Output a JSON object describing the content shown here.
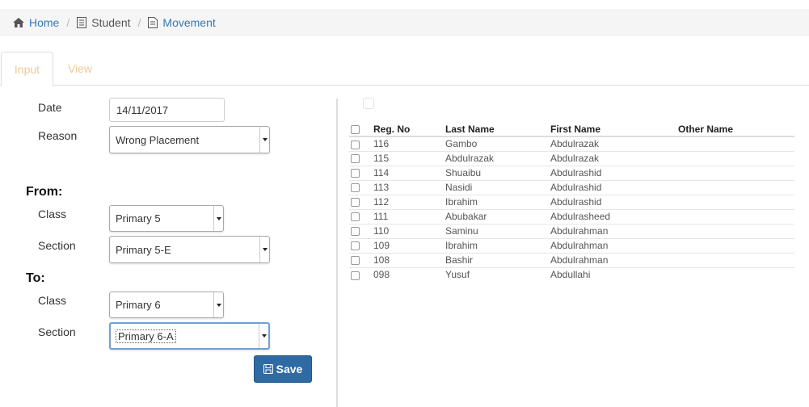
{
  "breadcrumb": {
    "home": "Home",
    "student": "Student",
    "movement": "Movement",
    "separator": "/"
  },
  "tabs": [
    {
      "label": "Input",
      "active": true
    },
    {
      "label": "View",
      "active": false
    }
  ],
  "form": {
    "date_label": "Date",
    "date_value": "14/11/2017",
    "reason_label": "Reason",
    "reason_value": "Wrong Placement",
    "from_heading": "From:",
    "from_class_label": "Class",
    "from_class_value": "Primary 5",
    "from_section_label": "Section",
    "from_section_value": "Primary 5-E",
    "to_heading": "To:",
    "to_class_label": "Class",
    "to_class_value": "Primary 6",
    "to_section_label": "Section",
    "to_section_value": "Primary 6-A",
    "save_label": "Save"
  },
  "table": {
    "headers": [
      "Reg. No",
      "Last Name",
      "First Name",
      "Other Name"
    ],
    "rows": [
      {
        "reg": "116",
        "last": "Gambo",
        "first": "Abdulrazak",
        "other": ""
      },
      {
        "reg": "115",
        "last": "Abdulrazak",
        "first": "Abdulrazak",
        "other": ""
      },
      {
        "reg": "114",
        "last": "Shuaibu",
        "first": "Abdulrashid",
        "other": ""
      },
      {
        "reg": "113",
        "last": "Nasidi",
        "first": "Abdulrashid",
        "other": ""
      },
      {
        "reg": "112",
        "last": "Ibrahim",
        "first": "Abdulrashid",
        "other": ""
      },
      {
        "reg": "111",
        "last": "Abubakar",
        "first": "Abdulrasheed",
        "other": ""
      },
      {
        "reg": "110",
        "last": "Saminu",
        "first": "Abdulrahman",
        "other": ""
      },
      {
        "reg": "109",
        "last": "Ibrahim",
        "first": "Abdulrahman",
        "other": ""
      },
      {
        "reg": "108",
        "last": "Bashir",
        "first": "Abdulrahman",
        "other": ""
      },
      {
        "reg": "098",
        "last": "Yusuf",
        "first": "Abdullahi",
        "other": ""
      }
    ]
  },
  "icons": {
    "home": "home-icon",
    "student": "document-icon",
    "movement": "document-icon",
    "save": "floppy-disk-icon"
  },
  "colors": {
    "link": "#337ab7",
    "tab_text": "#f0c79a",
    "save_button": "#2f6aa3"
  }
}
